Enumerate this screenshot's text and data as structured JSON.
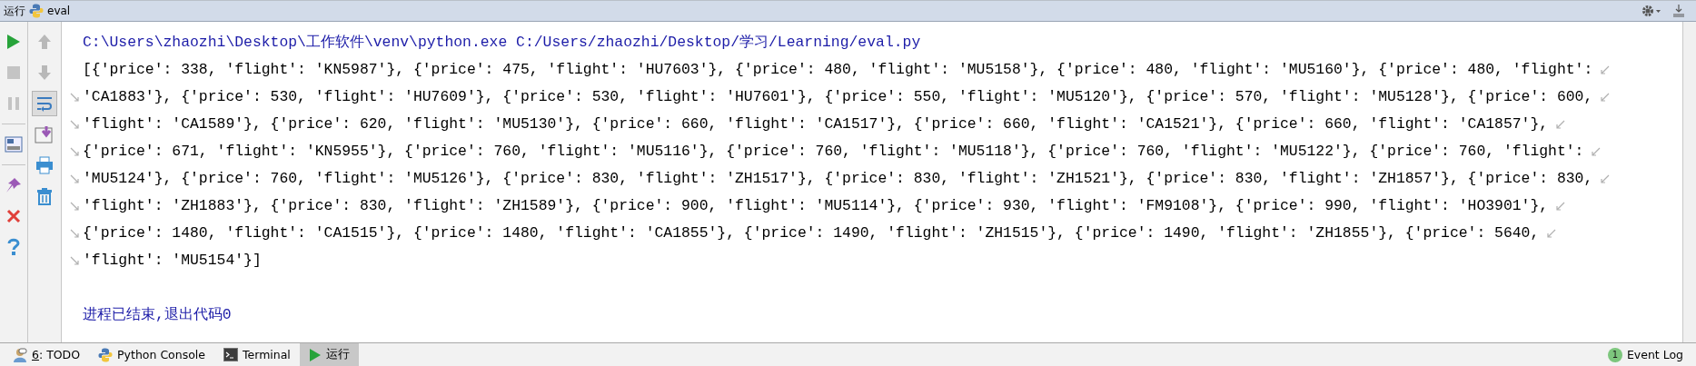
{
  "tool_window": {
    "title": "运行",
    "tab": "eval"
  },
  "left_toolbar": [
    {
      "kind": "run",
      "disabled": false
    },
    {
      "kind": "stop",
      "disabled": true
    },
    {
      "kind": "pause",
      "disabled": true
    },
    {
      "kind": "separator"
    },
    {
      "kind": "layout",
      "disabled": false
    },
    {
      "kind": "separator"
    },
    {
      "kind": "pin",
      "disabled": false
    },
    {
      "kind": "close",
      "disabled": false
    },
    {
      "kind": "help",
      "disabled": false
    }
  ],
  "second_toolbar": [
    {
      "kind": "up",
      "disabled": true,
      "selected": false
    },
    {
      "kind": "down",
      "disabled": true,
      "selected": false
    },
    {
      "kind": "soft_wrap",
      "disabled": false,
      "selected": true
    },
    {
      "kind": "scroll_end",
      "disabled": false,
      "selected": false
    },
    {
      "kind": "print",
      "disabled": false,
      "selected": false
    },
    {
      "kind": "trash",
      "disabled": false,
      "selected": false
    }
  ],
  "console": {
    "lines": [
      {
        "kind": "command",
        "text": "C:\\Users\\zhaozhi\\Desktop\\工作软件\\venv\\python.exe C:/Users/zhaozhi/Desktop/学习/Learning/eval.py"
      },
      {
        "kind": "output",
        "text": "[{'price': 338, 'flight': 'KN5987'}, {'price': 475, 'flight': 'HU7603'}, {'price': 480, 'flight': 'MU5158'}, {'price': 480, 'flight': 'MU5160'}, {'price': 480, 'flight':",
        "continued": false,
        "wraps": true
      },
      {
        "kind": "output",
        "text": "'CA1883'}, {'price': 530, 'flight': 'HU7609'}, {'price': 530, 'flight': 'HU7601'}, {'price': 550, 'flight': 'MU5120'}, {'price': 570, 'flight': 'MU5128'}, {'price': 600,",
        "continued": true,
        "wraps": true
      },
      {
        "kind": "output",
        "text": "'flight': 'CA1589'}, {'price': 620, 'flight': 'MU5130'}, {'price': 660, 'flight': 'CA1517'}, {'price': 660, 'flight': 'CA1521'}, {'price': 660, 'flight': 'CA1857'},",
        "continued": true,
        "wraps": true
      },
      {
        "kind": "output",
        "text": "{'price': 671, 'flight': 'KN5955'}, {'price': 760, 'flight': 'MU5116'}, {'price': 760, 'flight': 'MU5118'}, {'price': 760, 'flight': 'MU5122'}, {'price': 760, 'flight':",
        "continued": true,
        "wraps": true
      },
      {
        "kind": "output",
        "text": "'MU5124'}, {'price': 760, 'flight': 'MU5126'}, {'price': 830, 'flight': 'ZH1517'}, {'price': 830, 'flight': 'ZH1521'}, {'price': 830, 'flight': 'ZH1857'}, {'price': 830,",
        "continued": true,
        "wraps": true
      },
      {
        "kind": "output",
        "text": "'flight': 'ZH1883'}, {'price': 830, 'flight': 'ZH1589'}, {'price': 900, 'flight': 'MU5114'}, {'price': 930, 'flight': 'FM9108'}, {'price': 990, 'flight': 'HO3901'},",
        "continued": true,
        "wraps": true
      },
      {
        "kind": "output",
        "text": "{'price': 1480, 'flight': 'CA1515'}, {'price': 1480, 'flight': 'CA1855'}, {'price': 1490, 'flight': 'ZH1515'}, {'price': 1490, 'flight': 'ZH1855'}, {'price': 5640,",
        "continued": true,
        "wraps": true
      },
      {
        "kind": "output",
        "text": "'flight': 'MU5154'}]",
        "continued": true,
        "wraps": false
      },
      {
        "kind": "blank"
      },
      {
        "kind": "status",
        "text": "进程已结束,退出代码0"
      }
    ]
  },
  "bottom_tabs": [
    {
      "kind": "todo",
      "mnemonic": "6",
      "label": ": TODO",
      "selected": false
    },
    {
      "kind": "python_console",
      "label": "Python Console",
      "selected": false
    },
    {
      "kind": "terminal",
      "label": "Terminal",
      "selected": false
    },
    {
      "kind": "run",
      "label": "运行",
      "selected": true
    }
  ],
  "event_log": {
    "count": "1",
    "label": "Event Log"
  }
}
